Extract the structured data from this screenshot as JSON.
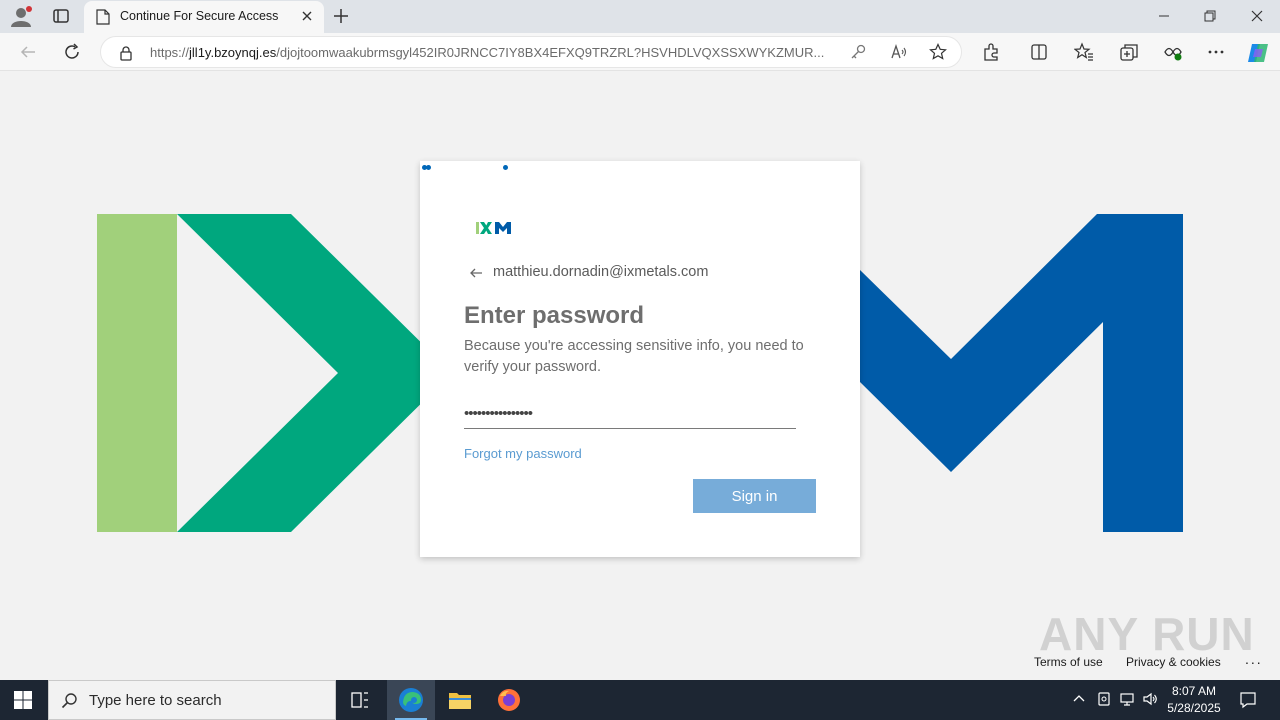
{
  "browser": {
    "tab_title": "Continue For Secure Access",
    "url_prefix": "https://",
    "url_domain": "jll1y.bzoynqj.es",
    "url_path": "/djojtoomwaakubrmsgyl452IR0JRNCC7IY8BX4EFXQ9TRZRL?HSVHDLVQXSSXWYKZMUR..."
  },
  "card": {
    "logo_text": "IXM",
    "email": "matthieu.dornadin@ixmetals.com",
    "heading": "Enter password",
    "description": "Because you're accessing sensitive info, you need to verify your password.",
    "password_value": "••••••••••••••••",
    "forgot_link": "Forgot my password",
    "signin_label": "Sign in"
  },
  "footer": {
    "terms": "Terms of use",
    "privacy": "Privacy & cookies",
    "more": "..."
  },
  "watermark": "ANY RUN",
  "taskbar": {
    "search_placeholder": "Type here to search",
    "time": "8:07 AM",
    "date": "5/28/2025"
  },
  "colors": {
    "brand_light_green": "#a1d07b",
    "brand_green": "#00a77e",
    "brand_blue": "#005ba8",
    "signin_button": "#77acd9",
    "link": "#5a9bd1"
  }
}
